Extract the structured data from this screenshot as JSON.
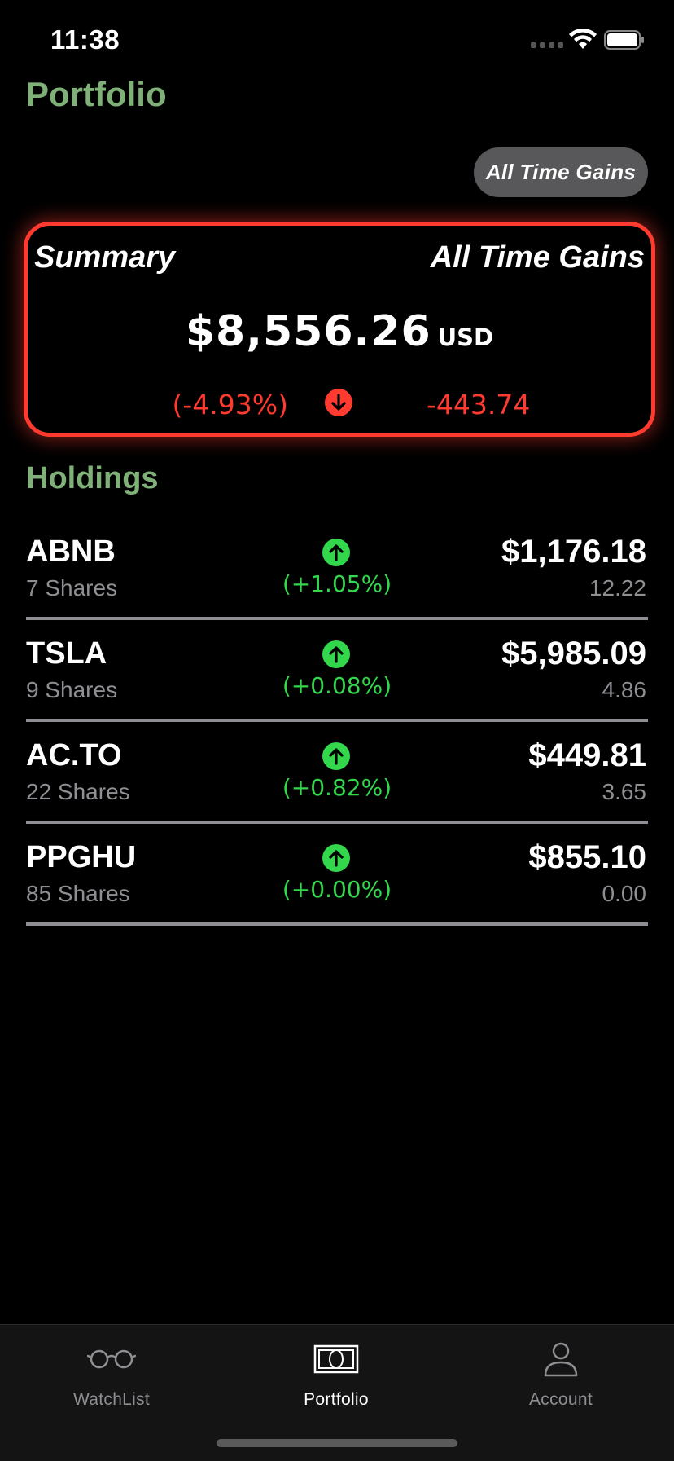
{
  "status_bar": {
    "time": "11:38"
  },
  "header": {
    "title": "Portfolio"
  },
  "gains_button": {
    "label": "All Time Gains"
  },
  "summary": {
    "label": "Summary",
    "mode": "All Time Gains",
    "value": "$8,556.26",
    "currency": "USD",
    "percent": "(-4.93%)",
    "change": "-443.74",
    "direction": "down",
    "color": "#ff3b30"
  },
  "holdings": {
    "title": "Holdings",
    "items": [
      {
        "symbol": "ABNB",
        "shares": "7 Shares",
        "percent": "(+1.05%)",
        "value": "$1,176.18",
        "change": "12.22",
        "direction": "up"
      },
      {
        "symbol": "TSLA",
        "shares": "9 Shares",
        "percent": "(+0.08%)",
        "value": "$5,985.09",
        "change": "4.86",
        "direction": "up"
      },
      {
        "symbol": "AC.TO",
        "shares": "22 Shares",
        "percent": "(+0.82%)",
        "value": "$449.81",
        "change": "3.65",
        "direction": "up"
      },
      {
        "symbol": "PPGHU",
        "shares": "85 Shares",
        "percent": "(+0.00%)",
        "value": "$855.10",
        "change": "0.00",
        "direction": "up"
      }
    ]
  },
  "tab_bar": {
    "tabs": [
      {
        "label": "WatchList",
        "icon": "glasses-icon",
        "active": false
      },
      {
        "label": "Portfolio",
        "icon": "banknote-icon",
        "active": true
      },
      {
        "label": "Account",
        "icon": "person-icon",
        "active": false
      }
    ]
  },
  "colors": {
    "accent_green": "#7fb077",
    "gain_green": "#32d74b",
    "loss_red": "#ff3b30",
    "background": "#000000"
  }
}
